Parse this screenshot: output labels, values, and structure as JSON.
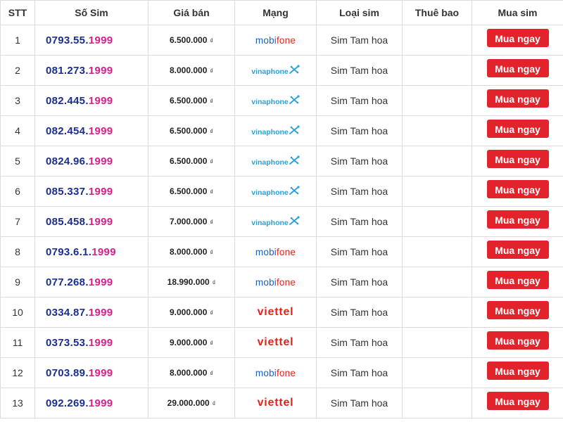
{
  "headers": [
    "STT",
    "Số Sim",
    "Giá bán",
    "Mạng",
    "Loại sim",
    "Thuê bao",
    "Mua sim"
  ],
  "currency": "₫",
  "buy_label": "Mua ngay",
  "networks": {
    "mobifone": {
      "part1": "mobi",
      "part2": "fone"
    },
    "vinaphone": {
      "text": "vinaphone"
    },
    "viettel": {
      "text": "viettel"
    }
  },
  "rows": [
    {
      "stt": "1",
      "num_head": "0793.55.",
      "num_tail": "1999",
      "price": "6.500.000",
      "network": "mobifone",
      "type": "Sim Tam hoa",
      "subscription": ""
    },
    {
      "stt": "2",
      "num_head": "081.273.",
      "num_tail": "1999",
      "price": "8.000.000",
      "network": "vinaphone",
      "type": "Sim Tam hoa",
      "subscription": ""
    },
    {
      "stt": "3",
      "num_head": "082.445.",
      "num_tail": "1999",
      "price": "6.500.000",
      "network": "vinaphone",
      "type": "Sim Tam hoa",
      "subscription": ""
    },
    {
      "stt": "4",
      "num_head": "082.454.",
      "num_tail": "1999",
      "price": "6.500.000",
      "network": "vinaphone",
      "type": "Sim Tam hoa",
      "subscription": ""
    },
    {
      "stt": "5",
      "num_head": "0824.96.",
      "num_tail": "1999",
      "price": "6.500.000",
      "network": "vinaphone",
      "type": "Sim Tam hoa",
      "subscription": ""
    },
    {
      "stt": "6",
      "num_head": "085.337.",
      "num_tail": "1999",
      "price": "6.500.000",
      "network": "vinaphone",
      "type": "Sim Tam hoa",
      "subscription": ""
    },
    {
      "stt": "7",
      "num_head": "085.458.",
      "num_tail": "1999",
      "price": "7.000.000",
      "network": "vinaphone",
      "type": "Sim Tam hoa",
      "subscription": ""
    },
    {
      "stt": "8",
      "num_head": "0793.6.1.",
      "num_tail": "1999",
      "price": "8.000.000",
      "network": "mobifone",
      "type": "Sim Tam hoa",
      "subscription": ""
    },
    {
      "stt": "9",
      "num_head": "077.268.",
      "num_tail": "1999",
      "price": "18.990.000",
      "network": "mobifone",
      "type": "Sim Tam hoa",
      "subscription": ""
    },
    {
      "stt": "10",
      "num_head": "0334.87.",
      "num_tail": "1999",
      "price": "9.000.000",
      "network": "viettel",
      "type": "Sim Tam hoa",
      "subscription": ""
    },
    {
      "stt": "11",
      "num_head": "0373.53.",
      "num_tail": "1999",
      "price": "9.000.000",
      "network": "viettel",
      "type": "Sim Tam hoa",
      "subscription": ""
    },
    {
      "stt": "12",
      "num_head": "0703.89.",
      "num_tail": "1999",
      "price": "8.000.000",
      "network": "mobifone",
      "type": "Sim Tam hoa",
      "subscription": ""
    },
    {
      "stt": "13",
      "num_head": "092.269.",
      "num_tail": "1999",
      "price": "29.000.000",
      "network": "viettel",
      "type": "Sim Tam hoa",
      "subscription": ""
    }
  ]
}
